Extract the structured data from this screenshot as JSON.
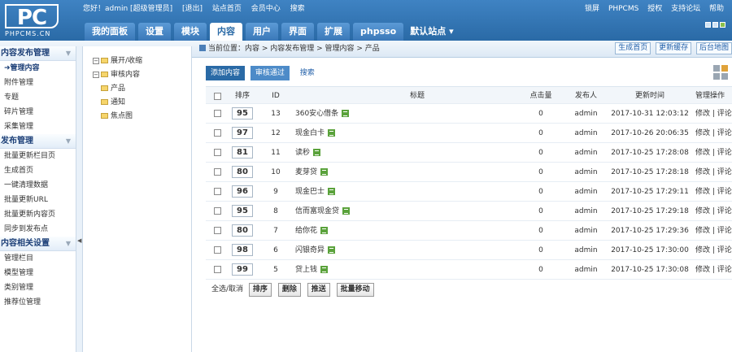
{
  "header": {
    "logo_text": "PC",
    "logo_sub": "PHPCMS.CN",
    "top_links": [
      "您好！admin [超级管理员]",
      "[退出]",
      "站点首页",
      "会员中心",
      "搜索"
    ],
    "right_links": [
      "锁屏",
      "PHPCMS",
      "授权",
      "支持论坛",
      "帮助"
    ],
    "nav_tabs": [
      "我的面板",
      "设置",
      "模块",
      "内容",
      "用户",
      "界面",
      "扩展",
      "phpsso"
    ],
    "active_tab": "内容",
    "site_select": "默认站点 ▾"
  },
  "sidebar": {
    "groups": [
      {
        "title": "内容发布管理",
        "items": [
          "管理内容",
          "附件管理",
          "专题",
          "碎片管理",
          "采集管理"
        ]
      },
      {
        "title": "发布管理",
        "items": [
          "批量更新栏目页",
          "生成首页",
          "一键清理数据",
          "批量更新URL",
          "批量更新内容页",
          "同步到发布点"
        ]
      },
      {
        "title": "内容相关设置",
        "items": [
          "管理栏目",
          "模型管理",
          "类别管理",
          "推荐位管理"
        ]
      }
    ],
    "active_item": "管理内容"
  },
  "tree": {
    "toggle": "展开/收缩",
    "root": "审核内容",
    "children": [
      "产品",
      "通知",
      "焦点图"
    ]
  },
  "breadcrumb": {
    "text": "当前位置：内容 > 内容发布管理 > 管理内容 > 产品",
    "buttons": [
      "生成首页",
      "更新缓存",
      "后台地图"
    ]
  },
  "actions": {
    "add": "添加内容",
    "passed": "审核通过",
    "search": "搜索"
  },
  "table": {
    "headers": [
      "排序",
      "ID",
      "标题",
      "点击量",
      "发布人",
      "更新时间",
      "管理操作"
    ],
    "rows": [
      {
        "sort": "95",
        "id": "13",
        "title": "360安心借条",
        "hits": "0",
        "publisher": "admin",
        "time": "2017-10-31 12:03:12",
        "ops": "修改 | 评论"
      },
      {
        "sort": "97",
        "id": "12",
        "title": "现金白卡",
        "hits": "0",
        "publisher": "admin",
        "time": "2017-10-26 20:06:35",
        "ops": "修改 | 评论"
      },
      {
        "sort": "81",
        "id": "11",
        "title": "读秒",
        "hits": "0",
        "publisher": "admin",
        "time": "2017-10-25 17:28:08",
        "ops": "修改 | 评论"
      },
      {
        "sort": "80",
        "id": "10",
        "title": "麦芽贷",
        "hits": "0",
        "publisher": "admin",
        "time": "2017-10-25 17:28:18",
        "ops": "修改 | 评论"
      },
      {
        "sort": "96",
        "id": "9",
        "title": "现金巴士",
        "hits": "0",
        "publisher": "admin",
        "time": "2017-10-25 17:29:11",
        "ops": "修改 | 评论"
      },
      {
        "sort": "95",
        "id": "8",
        "title": "信而富现金贷",
        "hits": "0",
        "publisher": "admin",
        "time": "2017-10-25 17:29:18",
        "ops": "修改 | 评论"
      },
      {
        "sort": "80",
        "id": "7",
        "title": "给你花",
        "hits": "0",
        "publisher": "admin",
        "time": "2017-10-25 17:29:36",
        "ops": "修改 | 评论"
      },
      {
        "sort": "98",
        "id": "6",
        "title": "闪银奇异",
        "hits": "0",
        "publisher": "admin",
        "time": "2017-10-25 17:30:00",
        "ops": "修改 | 评论"
      },
      {
        "sort": "99",
        "id": "5",
        "title": "贷上钱",
        "hits": "0",
        "publisher": "admin",
        "time": "2017-10-25 17:30:08",
        "ops": "修改 | 评论"
      }
    ]
  },
  "footer": {
    "select_all": "全选/取消",
    "buttons": [
      "排序",
      "删除",
      "推送",
      "批量移动"
    ]
  },
  "colors": {
    "header": "#2a6aa6",
    "accent": "#1f5ea8"
  }
}
